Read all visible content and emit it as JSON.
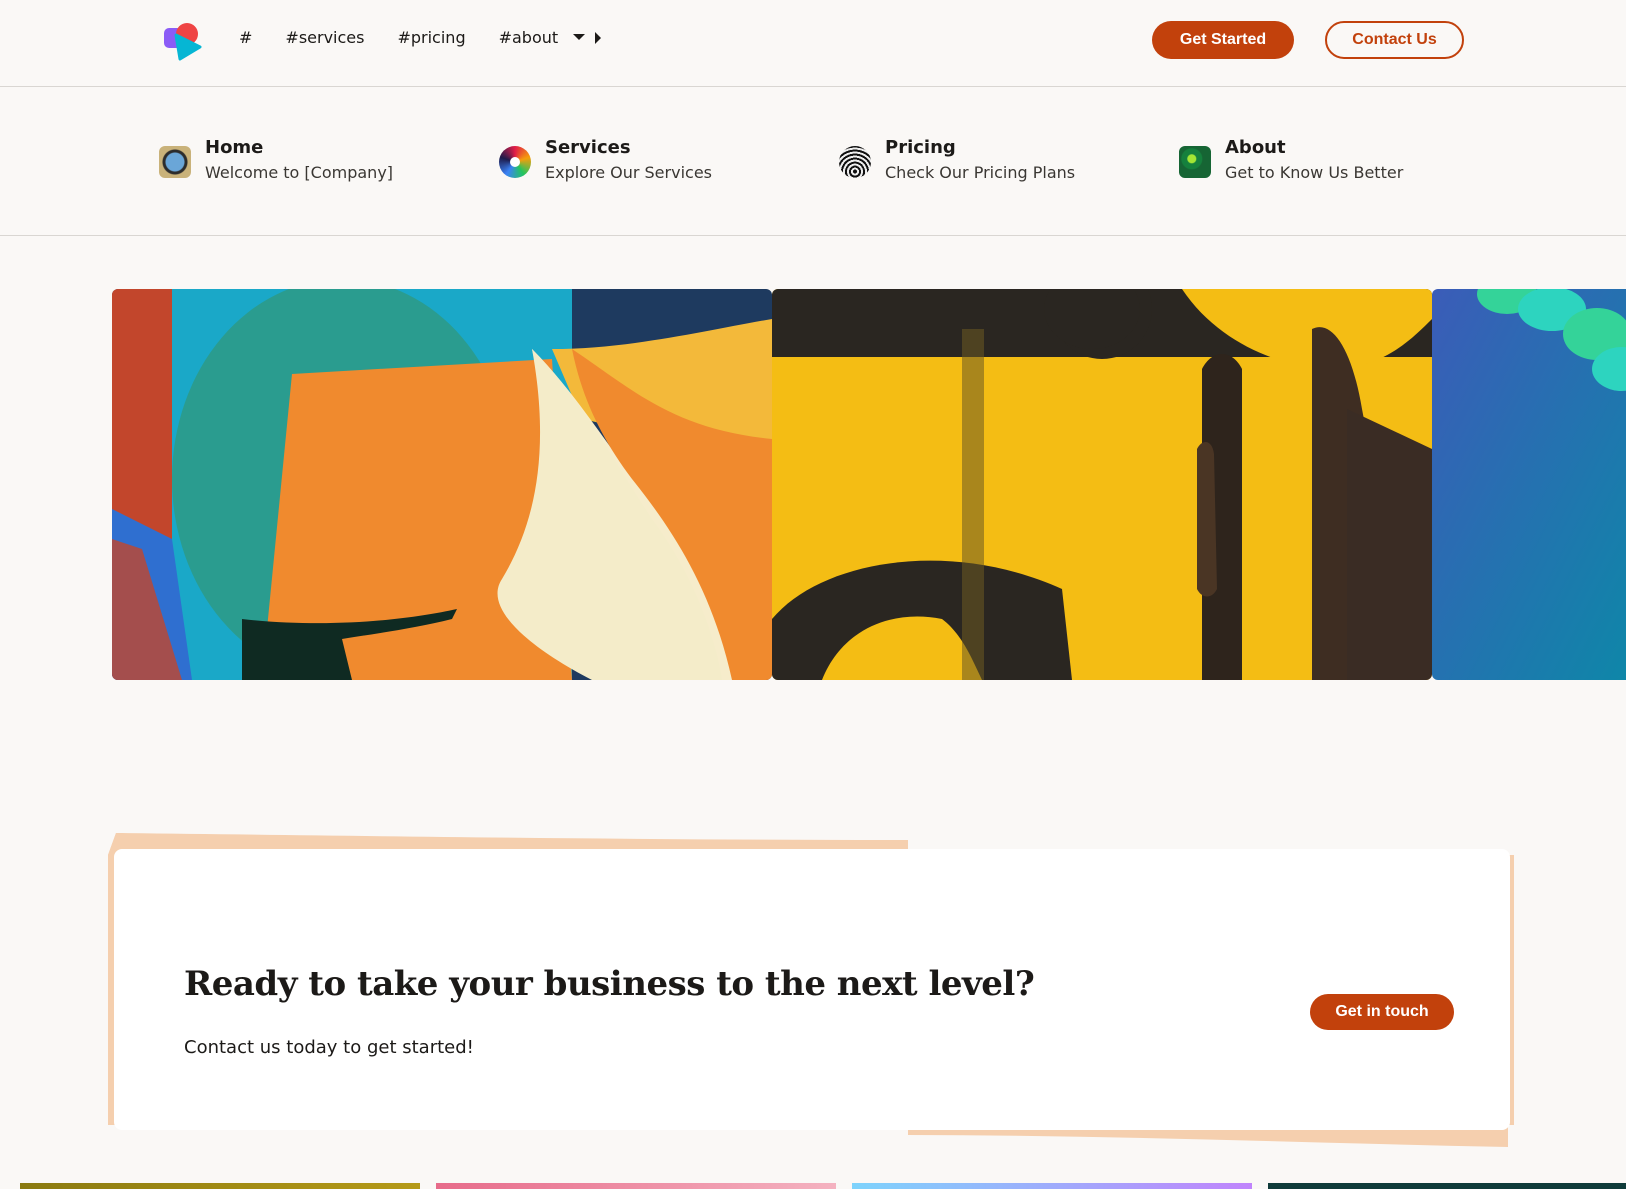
{
  "nav": {
    "links": [
      "#",
      "#services",
      "#pricing",
      "#about"
    ],
    "get_started": "Get Started",
    "contact_us": "Contact Us"
  },
  "submenu": {
    "items": [
      {
        "title": "Home",
        "desc": "Welcome to [Company]"
      },
      {
        "title": "Services",
        "desc": "Explore Our Services"
      },
      {
        "title": "Pricing",
        "desc": "Check Our Pricing Plans"
      },
      {
        "title": "About",
        "desc": "Get to Know Us Better"
      }
    ]
  },
  "cta": {
    "title": "Ready to take your business to the next level?",
    "text": "Contact us today to get started!",
    "button": "Get in touch"
  },
  "colors": {
    "accent": "#c2410c",
    "background": "#faf8f6",
    "peach": "#f5cfae"
  }
}
